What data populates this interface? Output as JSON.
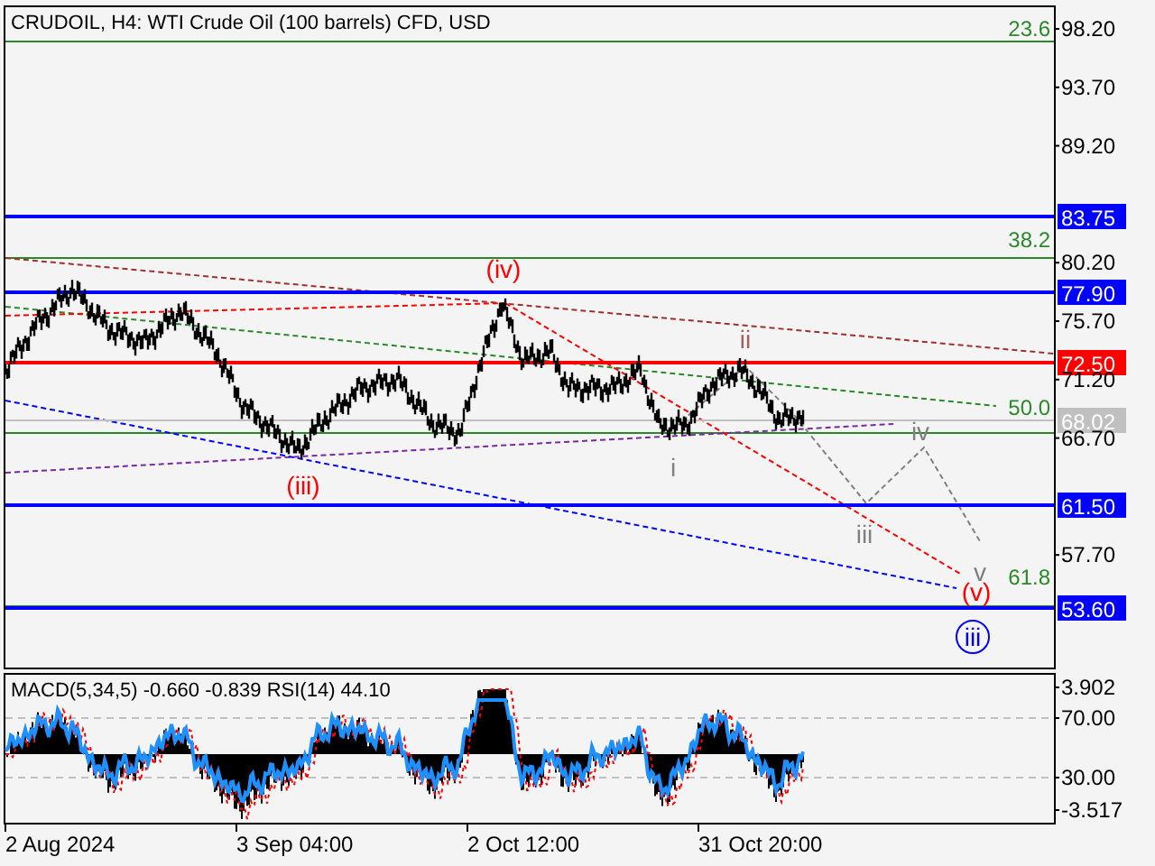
{
  "chart": {
    "title": "CRUDOIL, H4:  WTI Crude Oil (100 barrels) CFD, USD"
  },
  "price_axis": {
    "ticks": [
      "98.20",
      "93.70",
      "89.20",
      "80.20",
      "75.70",
      "71.20",
      "66.70",
      "57.70"
    ]
  },
  "price_levels": [
    {
      "label": "83.75",
      "color": "#0000ff"
    },
    {
      "label": "77.90",
      "color": "#0000ff"
    },
    {
      "label": "72.50",
      "color": "#ff0000"
    },
    {
      "label": "68.02",
      "color": "#c0c0c0"
    },
    {
      "label": "61.50",
      "color": "#0000ff"
    },
    {
      "label": "53.60",
      "color": "#0000ff"
    }
  ],
  "fibonacci_levels": [
    "23.6",
    "38.2",
    "50.0",
    "61.8"
  ],
  "wave_labels": [
    {
      "text": "(iv)",
      "color": "#ff0000",
      "kind": "plain"
    },
    {
      "text": "(iii)",
      "color": "#ff0000",
      "kind": "plain"
    },
    {
      "text": "i",
      "color": "#808080",
      "kind": "plain"
    },
    {
      "text": "ii",
      "color": "#a06060",
      "kind": "plain"
    },
    {
      "text": "iii",
      "color": "#808080",
      "kind": "plain"
    },
    {
      "text": "iv",
      "color": "#808080",
      "kind": "plain"
    },
    {
      "text": "v",
      "color": "#808080",
      "kind": "plain"
    },
    {
      "text": "(v)",
      "color": "#ff0000",
      "kind": "plain"
    },
    {
      "text": "iii",
      "color": "#0000ff",
      "kind": "circled"
    }
  ],
  "indicator": {
    "legend": "MACD(5,34,5) -0.660 -0.839 RSI(14) 44.10",
    "axis": [
      "3.902",
      "70.00",
      "30.00",
      "-3.517"
    ]
  },
  "time_axis": [
    "2 Aug 2024",
    "3 Sep 04:00",
    "2 Oct 12:00",
    "31 Oct 20:00"
  ]
}
